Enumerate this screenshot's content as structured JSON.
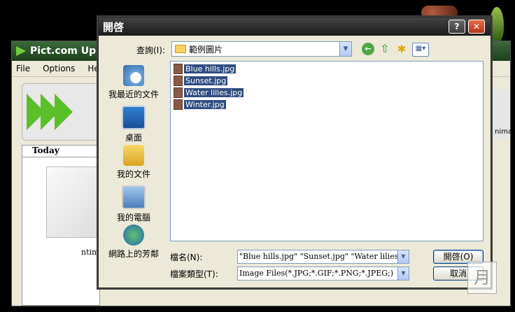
{
  "background_app": {
    "title": "Pict.com Uploa",
    "menu": [
      "File",
      "Options",
      "He"
    ],
    "today_header": "Today",
    "caption": "ntim",
    "right_text": "nimag"
  },
  "dialog": {
    "title": "開啓",
    "help_label": "?",
    "close_label": "✕",
    "look_in_label": "查詢(I):",
    "look_in_value": "範例圖片",
    "places": [
      {
        "label": "我最近的文件",
        "icon": "recent-documents-icon"
      },
      {
        "label": "桌面",
        "icon": "desktop-icon"
      },
      {
        "label": "我的文件",
        "icon": "my-documents-icon"
      },
      {
        "label": "我的電腦",
        "icon": "my-computer-icon"
      },
      {
        "label": "網路上的芳鄰",
        "icon": "network-places-icon"
      }
    ],
    "files": [
      "Blue hills.jpg",
      "Sunset.jpg",
      "Water lilies.jpg",
      "Winter.jpg"
    ],
    "filename_label": "檔名(N):",
    "filename_value": "\"Blue hills.jpg\" \"Sunset.jpg\" \"Water lilies.jpg\" \"",
    "filetype_label": "檔案類型(T):",
    "filetype_value": "Image Files(*.JPG;*.GIF;*.PNG;*.JPEG;)",
    "open_button": "開啓(O)",
    "cancel_button": "取消"
  }
}
